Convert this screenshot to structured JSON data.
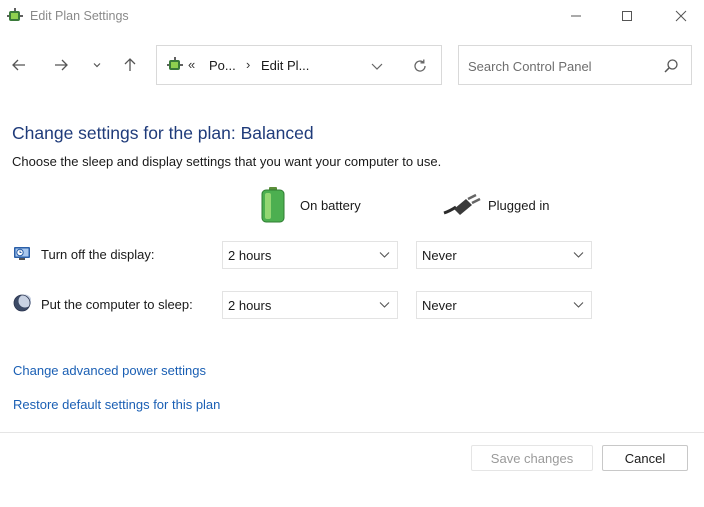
{
  "window": {
    "title": "Edit Plan Settings",
    "icon": "power-options-icon",
    "controls": [
      "minimize-icon",
      "maximize-icon",
      "close-icon"
    ]
  },
  "navigation": {
    "back_icon": "arrow-left-icon",
    "forward_icon": "arrow-right-icon",
    "recent_icon": "chevron-down-icon",
    "up_icon": "arrow-up-icon",
    "breadcrumb": {
      "icon": "power-options-icon",
      "overflow": "«",
      "items": [
        "Po...",
        "Edit Pl..."
      ],
      "separator": "›"
    },
    "refresh_icon": "refresh-icon"
  },
  "search": {
    "placeholder": "Search Control Panel",
    "value": "",
    "icon": "search-icon"
  },
  "main": {
    "heading": "Change settings for the plan: Balanced",
    "subheading": "Choose the sleep and display settings that you want your computer to use.",
    "columns": [
      {
        "label": "On battery",
        "icon": "battery-icon"
      },
      {
        "label": "Plugged in",
        "icon": "power-plug-icon"
      }
    ],
    "rows": [
      {
        "label": "Turn off the display:",
        "icon": "display-timer-icon",
        "on_battery": "2 hours",
        "plugged_in": "Never"
      },
      {
        "label": "Put the computer to sleep:",
        "icon": "sleep-moon-icon",
        "on_battery": "2 hours",
        "plugged_in": "Never"
      }
    ],
    "links": [
      "Change advanced power settings",
      "Restore default settings for this plan"
    ]
  },
  "footer": {
    "save_label": "Save changes",
    "save_enabled": false,
    "cancel_label": "Cancel"
  },
  "colors": {
    "heading": "#1f3b7a",
    "link": "#1a5fb4",
    "disabled_text": "#9a9a9a"
  }
}
